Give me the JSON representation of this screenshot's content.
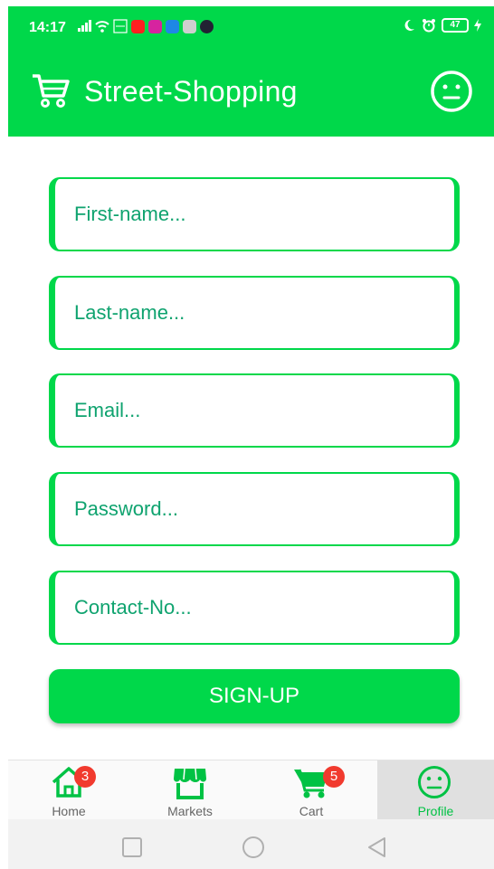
{
  "status_bar": {
    "time": "14:17",
    "battery_level": "47"
  },
  "app_bar": {
    "title": "Street-Shopping",
    "logo_icon": "cart-icon",
    "profile_icon": "smiley-face-icon"
  },
  "form": {
    "first_name": {
      "placeholder": "First-name...",
      "value": ""
    },
    "last_name": {
      "placeholder": "Last-name...",
      "value": ""
    },
    "email": {
      "placeholder": "Email...",
      "value": ""
    },
    "password": {
      "placeholder": "Password...",
      "value": ""
    },
    "contact": {
      "placeholder": "Contact-No...",
      "value": ""
    },
    "submit_label": "SIGN-UP"
  },
  "bottom_nav": {
    "items": [
      {
        "label": "Home",
        "icon": "home-icon",
        "badge": "3"
      },
      {
        "label": "Markets",
        "icon": "store-icon"
      },
      {
        "label": "Cart",
        "icon": "cart-icon",
        "badge": "5"
      },
      {
        "label": "Profile",
        "icon": "smiley-face-icon",
        "active": true
      }
    ]
  },
  "colors": {
    "primary": "#00d84a",
    "input_text": "#0fa36f",
    "badge": "#f13a2e"
  }
}
